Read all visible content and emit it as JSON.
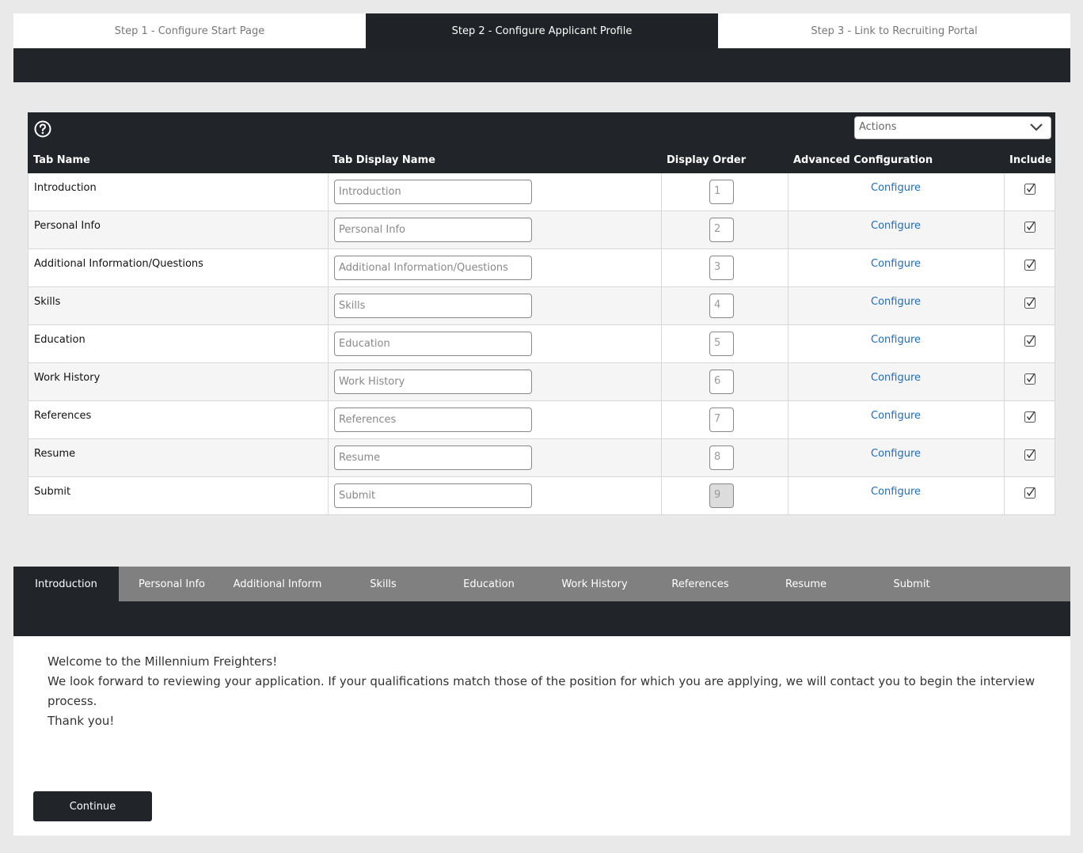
{
  "steps": [
    {
      "label": "Step 1 - Configure Start Page",
      "active": false
    },
    {
      "label": "Step 2 - Configure Applicant Profile",
      "active": true
    },
    {
      "label": "Step 3 - Link to Recruiting Portal",
      "active": false
    }
  ],
  "toolbar": {
    "help_icon": "question-circle-icon",
    "actions_placeholder": "Actions"
  },
  "columns": {
    "tab_name": "Tab Name",
    "tab_display_name": "Tab Display Name",
    "display_order": "Display Order",
    "advanced_configuration": "Advanced Configuration",
    "include": "Include"
  },
  "rows": [
    {
      "name": "Introduction",
      "display": "Introduction",
      "order": "1",
      "link": "Configure",
      "include": true,
      "order_disabled": false
    },
    {
      "name": "Personal Info",
      "display": "Personal Info",
      "order": "2",
      "link": "Configure",
      "include": true,
      "order_disabled": false
    },
    {
      "name": "Additional Information/Questions",
      "display": "Additional Information/Questions",
      "order": "3",
      "link": "Configure",
      "include": true,
      "order_disabled": false
    },
    {
      "name": "Skills",
      "display": "Skills",
      "order": "4",
      "link": "Configure",
      "include": true,
      "order_disabled": false
    },
    {
      "name": "Education",
      "display": "Education",
      "order": "5",
      "link": "Configure",
      "include": true,
      "order_disabled": false
    },
    {
      "name": "Work History",
      "display": "Work History",
      "order": "6",
      "link": "Configure",
      "include": true,
      "order_disabled": false
    },
    {
      "name": "References",
      "display": "References",
      "order": "7",
      "link": "Configure",
      "include": true,
      "order_disabled": false
    },
    {
      "name": "Resume",
      "display": "Resume",
      "order": "8",
      "link": "Configure",
      "include": true,
      "order_disabled": false
    },
    {
      "name": "Submit",
      "display": "Submit",
      "order": "9",
      "link": "Configure",
      "include": true,
      "order_disabled": true
    }
  ],
  "preview": {
    "tabs": [
      {
        "label": "Introduction",
        "active": true
      },
      {
        "label": "Personal Info",
        "active": false
      },
      {
        "label": "Additional Inform",
        "active": false
      },
      {
        "label": "Skills",
        "active": false
      },
      {
        "label": "Education",
        "active": false
      },
      {
        "label": "Work History",
        "active": false
      },
      {
        "label": "References",
        "active": false
      },
      {
        "label": "Resume",
        "active": false
      },
      {
        "label": "Submit",
        "active": false
      }
    ],
    "lines": [
      "Welcome to the Millennium Freighters!",
      "We look forward to reviewing your application. If your qualifications match those of the position for which you are applying, we will contact you to begin the interview process.",
      "Thank you!"
    ],
    "continue_label": "Continue"
  }
}
